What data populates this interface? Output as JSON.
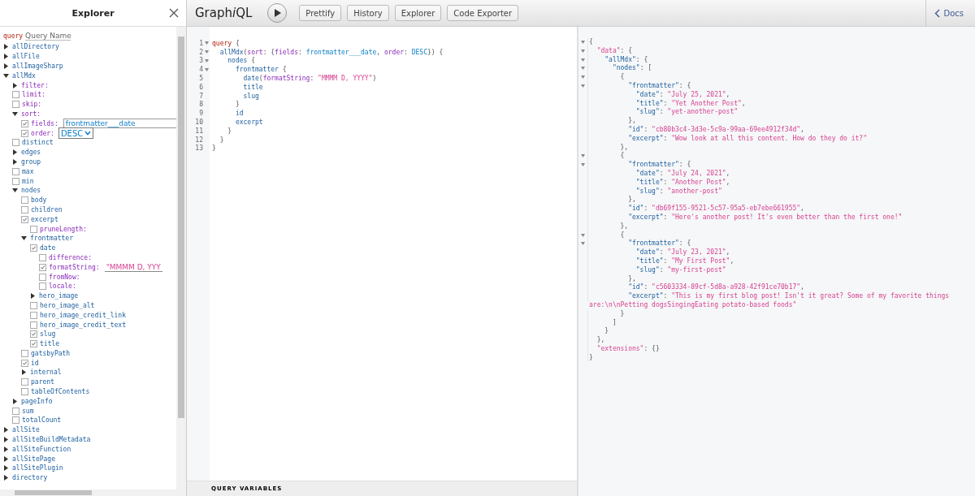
{
  "explorer": {
    "title": "Explorer",
    "operation": {
      "keyword": "query",
      "placeholder": "Query Name"
    },
    "tree": [
      {
        "label": "allDirectory",
        "kind": "object",
        "expanded": false
      },
      {
        "label": "allFile",
        "kind": "object",
        "expanded": false
      },
      {
        "label": "allImageSharp",
        "kind": "object",
        "expanded": false
      },
      {
        "label": "allMdx",
        "kind": "object",
        "expanded": true,
        "children": [
          {
            "label": "filter:",
            "kind": "arg_object",
            "expanded": false
          },
          {
            "label": "limit:",
            "kind": "arg",
            "checked": false
          },
          {
            "label": "skip:",
            "kind": "arg",
            "checked": false
          },
          {
            "label": "sort:",
            "kind": "arg_object",
            "expanded": true,
            "children": [
              {
                "label": "fields:",
                "kind": "arg",
                "checked": true,
                "value": {
                  "text": "frontmatter___date",
                  "kind": "enum"
                }
              },
              {
                "label": "order:",
                "kind": "arg",
                "checked": true,
                "select": "DESC"
              }
            ]
          },
          {
            "label": "distinct",
            "kind": "field",
            "checked": false
          },
          {
            "label": "edges",
            "kind": "object",
            "expanded": false
          },
          {
            "label": "group",
            "kind": "object",
            "expanded": false
          },
          {
            "label": "max",
            "kind": "field",
            "checked": false
          },
          {
            "label": "min",
            "kind": "field",
            "checked": false
          },
          {
            "label": "nodes",
            "kind": "object",
            "expanded": true,
            "children": [
              {
                "label": "body",
                "kind": "field",
                "checked": false
              },
              {
                "label": "children",
                "kind": "field",
                "checked": false
              },
              {
                "label": "excerpt",
                "kind": "field",
                "checked": true,
                "children": [
                  {
                    "label": "pruneLength:",
                    "kind": "arg",
                    "checked": false
                  }
                ]
              },
              {
                "label": "frontmatter",
                "kind": "object",
                "expanded": true,
                "children": [
                  {
                    "label": "date",
                    "kind": "field",
                    "checked": true,
                    "children": [
                      {
                        "label": "difference:",
                        "kind": "arg",
                        "checked": false
                      },
                      {
                        "label": "formatString:",
                        "kind": "arg",
                        "checked": true,
                        "value": {
                          "text": "\"MMMM D, YYY",
                          "kind": "string"
                        }
                      },
                      {
                        "label": "fromNow:",
                        "kind": "arg",
                        "checked": false
                      },
                      {
                        "label": "locale:",
                        "kind": "arg",
                        "checked": false
                      }
                    ]
                  },
                  {
                    "label": "hero_image",
                    "kind": "object",
                    "expanded": false
                  },
                  {
                    "label": "hero_image_alt",
                    "kind": "field",
                    "checked": false
                  },
                  {
                    "label": "hero_image_credit_link",
                    "kind": "field",
                    "checked": false
                  },
                  {
                    "label": "hero_image_credit_text",
                    "kind": "field",
                    "checked": false
                  },
                  {
                    "label": "slug",
                    "kind": "field",
                    "checked": true
                  },
                  {
                    "label": "title",
                    "kind": "field",
                    "checked": true
                  }
                ]
              },
              {
                "label": "gatsbyPath",
                "kind": "field",
                "checked": false
              },
              {
                "label": "id",
                "kind": "field",
                "checked": true
              },
              {
                "label": "internal",
                "kind": "object",
                "expanded": false
              },
              {
                "label": "parent",
                "kind": "field",
                "checked": false
              },
              {
                "label": "tableOfContents",
                "kind": "field",
                "checked": false
              }
            ]
          },
          {
            "label": "pageInfo",
            "kind": "object",
            "expanded": false
          },
          {
            "label": "sum",
            "kind": "field",
            "checked": false
          },
          {
            "label": "totalCount",
            "kind": "field",
            "checked": false
          }
        ]
      },
      {
        "label": "allSite",
        "kind": "object",
        "expanded": false
      },
      {
        "label": "allSiteBuildMetadata",
        "kind": "object",
        "expanded": false
      },
      {
        "label": "allSiteFunction",
        "kind": "object",
        "expanded": false
      },
      {
        "label": "allSitePage",
        "kind": "object",
        "expanded": false
      },
      {
        "label": "allSitePlugin",
        "kind": "object",
        "expanded": false
      },
      {
        "label": "directory",
        "kind": "object",
        "expanded": false
      }
    ]
  },
  "toolbar": {
    "logo": [
      {
        "text": "Graph",
        "italic": false
      },
      {
        "text": "i",
        "italic": true
      },
      {
        "text": "QL",
        "italic": false
      }
    ],
    "buttons": [
      "Prettify",
      "History",
      "Explorer",
      "Code Exporter"
    ],
    "docs": "Docs"
  },
  "query_editor": {
    "lines": [
      {
        "number": "1",
        "foldable": true,
        "tokens": [
          {
            "text": "query",
            "kind": "keyword"
          },
          {
            "text": " {",
            "kind": "punct"
          }
        ]
      },
      {
        "number": "2",
        "foldable": true,
        "tokens": [
          {
            "text": "  allMdx",
            "kind": "property"
          },
          {
            "text": "(",
            "kind": "punct"
          },
          {
            "text": "sort",
            "kind": "attribute"
          },
          {
            "text": ": {",
            "kind": "punct"
          },
          {
            "text": "fields",
            "kind": "attribute"
          },
          {
            "text": ": ",
            "kind": "punct"
          },
          {
            "text": "frontmatter___date",
            "kind": "enum"
          },
          {
            "text": ", ",
            "kind": "punct"
          },
          {
            "text": "order",
            "kind": "attribute"
          },
          {
            "text": ": ",
            "kind": "punct"
          },
          {
            "text": "DESC",
            "kind": "enum"
          },
          {
            "text": "}) {",
            "kind": "punct"
          }
        ]
      },
      {
        "number": "3",
        "foldable": true,
        "tokens": [
          {
            "text": "    nodes",
            "kind": "property"
          },
          {
            "text": " {",
            "kind": "punct"
          }
        ]
      },
      {
        "number": "4",
        "foldable": true,
        "tokens": [
          {
            "text": "      frontmatter",
            "kind": "property"
          },
          {
            "text": " {",
            "kind": "punct"
          }
        ]
      },
      {
        "number": "5",
        "foldable": false,
        "tokens": [
          {
            "text": "        date",
            "kind": "property"
          },
          {
            "text": "(",
            "kind": "punct"
          },
          {
            "text": "formatString",
            "kind": "attribute"
          },
          {
            "text": ": ",
            "kind": "punct"
          },
          {
            "text": "\"MMMM D, YYYY\"",
            "kind": "string"
          },
          {
            "text": ")",
            "kind": "punct"
          }
        ]
      },
      {
        "number": "6",
        "foldable": false,
        "tokens": [
          {
            "text": "        title",
            "kind": "property"
          }
        ]
      },
      {
        "number": "7",
        "foldable": false,
        "tokens": [
          {
            "text": "        slug",
            "kind": "property"
          }
        ]
      },
      {
        "number": "8",
        "foldable": false,
        "tokens": [
          {
            "text": "      }",
            "kind": "punct"
          }
        ]
      },
      {
        "number": "9",
        "foldable": false,
        "tokens": [
          {
            "text": "      id",
            "kind": "property"
          }
        ]
      },
      {
        "number": "10",
        "foldable": false,
        "tokens": [
          {
            "text": "      excerpt",
            "kind": "property"
          }
        ]
      },
      {
        "number": "11",
        "foldable": false,
        "tokens": [
          {
            "text": "    }",
            "kind": "punct"
          }
        ]
      },
      {
        "number": "12",
        "foldable": false,
        "tokens": [
          {
            "text": "  }",
            "kind": "punct"
          }
        ]
      },
      {
        "number": "13",
        "foldable": false,
        "tokens": [
          {
            "text": "}",
            "kind": "punct"
          }
        ]
      }
    ],
    "variables_label": "QUERY VARIABLES"
  },
  "result": {
    "lines": [
      {
        "foldable": true,
        "tokens": [
          {
            "text": "{",
            "kind": "punct"
          }
        ]
      },
      {
        "foldable": true,
        "tokens": [
          {
            "text": "  \"data\"",
            "kind": "string"
          },
          {
            "text": ": {",
            "kind": "punct"
          }
        ]
      },
      {
        "foldable": true,
        "tokens": [
          {
            "text": "    \"allMdx\"",
            "kind": "property"
          },
          {
            "text": ": {",
            "kind": "punct"
          }
        ]
      },
      {
        "foldable": true,
        "tokens": [
          {
            "text": "      \"nodes\"",
            "kind": "property"
          },
          {
            "text": ": [",
            "kind": "punct"
          }
        ]
      },
      {
        "foldable": true,
        "tokens": [
          {
            "text": "        {",
            "kind": "punct"
          }
        ]
      },
      {
        "foldable": true,
        "tokens": [
          {
            "text": "          \"frontmatter\"",
            "kind": "property"
          },
          {
            "text": ": {",
            "kind": "punct"
          }
        ]
      },
      {
        "foldable": false,
        "tokens": [
          {
            "text": "            \"date\"",
            "kind": "property"
          },
          {
            "text": ": ",
            "kind": "punct"
          },
          {
            "text": "\"July 25, 2021\"",
            "kind": "string"
          },
          {
            "text": ",",
            "kind": "punct"
          }
        ]
      },
      {
        "foldable": false,
        "tokens": [
          {
            "text": "            \"title\"",
            "kind": "property"
          },
          {
            "text": ": ",
            "kind": "punct"
          },
          {
            "text": "\"Yet Another Post\"",
            "kind": "string"
          },
          {
            "text": ",",
            "kind": "punct"
          }
        ]
      },
      {
        "foldable": false,
        "tokens": [
          {
            "text": "            \"slug\"",
            "kind": "property"
          },
          {
            "text": ": ",
            "kind": "punct"
          },
          {
            "text": "\"yet-another-post\"",
            "kind": "string"
          }
        ]
      },
      {
        "foldable": false,
        "tokens": [
          {
            "text": "          },",
            "kind": "punct"
          }
        ]
      },
      {
        "foldable": false,
        "tokens": [
          {
            "text": "          \"id\"",
            "kind": "property"
          },
          {
            "text": ": ",
            "kind": "punct"
          },
          {
            "text": "\"cb80b3c4-3d3e-5c9a-99aa-69ee4912f34d\"",
            "kind": "string"
          },
          {
            "text": ",",
            "kind": "punct"
          }
        ]
      },
      {
        "foldable": false,
        "tokens": [
          {
            "text": "          \"excerpt\"",
            "kind": "property"
          },
          {
            "text": ": ",
            "kind": "punct"
          },
          {
            "text": "\"Wow look at all this content. How do they do it?\"",
            "kind": "string"
          }
        ]
      },
      {
        "foldable": false,
        "tokens": [
          {
            "text": "        },",
            "kind": "punct"
          }
        ]
      },
      {
        "foldable": true,
        "tokens": [
          {
            "text": "        {",
            "kind": "punct"
          }
        ]
      },
      {
        "foldable": true,
        "tokens": [
          {
            "text": "          \"frontmatter\"",
            "kind": "property"
          },
          {
            "text": ": {",
            "kind": "punct"
          }
        ]
      },
      {
        "foldable": false,
        "tokens": [
          {
            "text": "            \"date\"",
            "kind": "property"
          },
          {
            "text": ": ",
            "kind": "punct"
          },
          {
            "text": "\"July 24, 2021\"",
            "kind": "string"
          },
          {
            "text": ",",
            "kind": "punct"
          }
        ]
      },
      {
        "foldable": false,
        "tokens": [
          {
            "text": "            \"title\"",
            "kind": "property"
          },
          {
            "text": ": ",
            "kind": "punct"
          },
          {
            "text": "\"Another Post\"",
            "kind": "string"
          },
          {
            "text": ",",
            "kind": "punct"
          }
        ]
      },
      {
        "foldable": false,
        "tokens": [
          {
            "text": "            \"slug\"",
            "kind": "property"
          },
          {
            "text": ": ",
            "kind": "punct"
          },
          {
            "text": "\"another-post\"",
            "kind": "string"
          }
        ]
      },
      {
        "foldable": false,
        "tokens": [
          {
            "text": "          },",
            "kind": "punct"
          }
        ]
      },
      {
        "foldable": false,
        "tokens": [
          {
            "text": "          \"id\"",
            "kind": "property"
          },
          {
            "text": ": ",
            "kind": "punct"
          },
          {
            "text": "\"db69f155-9521-5c57-95a5-eb7ebe661955\"",
            "kind": "string"
          },
          {
            "text": ",",
            "kind": "punct"
          }
        ]
      },
      {
        "foldable": false,
        "tokens": [
          {
            "text": "          \"excerpt\"",
            "kind": "property"
          },
          {
            "text": ": ",
            "kind": "punct"
          },
          {
            "text": "\"Here's another post! It's even better than the first one!\"",
            "kind": "string"
          }
        ]
      },
      {
        "foldable": false,
        "tokens": [
          {
            "text": "        },",
            "kind": "punct"
          }
        ]
      },
      {
        "foldable": true,
        "tokens": [
          {
            "text": "        {",
            "kind": "punct"
          }
        ]
      },
      {
        "foldable": true,
        "tokens": [
          {
            "text": "          \"frontmatter\"",
            "kind": "property"
          },
          {
            "text": ": {",
            "kind": "punct"
          }
        ]
      },
      {
        "foldable": false,
        "tokens": [
          {
            "text": "            \"date\"",
            "kind": "property"
          },
          {
            "text": ": ",
            "kind": "punct"
          },
          {
            "text": "\"July 23, 2021\"",
            "kind": "string"
          },
          {
            "text": ",",
            "kind": "punct"
          }
        ]
      },
      {
        "foldable": false,
        "tokens": [
          {
            "text": "            \"title\"",
            "kind": "property"
          },
          {
            "text": ": ",
            "kind": "punct"
          },
          {
            "text": "\"My First Post\"",
            "kind": "string"
          },
          {
            "text": ",",
            "kind": "punct"
          }
        ]
      },
      {
        "foldable": false,
        "tokens": [
          {
            "text": "            \"slug\"",
            "kind": "property"
          },
          {
            "text": ": ",
            "kind": "punct"
          },
          {
            "text": "\"my-first-post\"",
            "kind": "string"
          }
        ]
      },
      {
        "foldable": false,
        "tokens": [
          {
            "text": "          },",
            "kind": "punct"
          }
        ]
      },
      {
        "foldable": false,
        "tokens": [
          {
            "text": "          \"id\"",
            "kind": "property"
          },
          {
            "text": ": ",
            "kind": "punct"
          },
          {
            "text": "\"c5603334-89cf-5d8a-a928-42f91ce70b17\"",
            "kind": "string"
          },
          {
            "text": ",",
            "kind": "punct"
          }
        ]
      },
      {
        "foldable": false,
        "tokens": [
          {
            "text": "          \"excerpt\"",
            "kind": "property"
          },
          {
            "text": ": ",
            "kind": "punct"
          },
          {
            "text": "\"This is my first blog post! Isn't it great? Some of my favorite things are:\\n\\nPetting dogsSingingEating potato-based foods\"",
            "kind": "string"
          }
        ]
      },
      {
        "foldable": false,
        "tokens": [
          {
            "text": "        }",
            "kind": "punct"
          }
        ]
      },
      {
        "foldable": false,
        "tokens": [
          {
            "text": "      ]",
            "kind": "punct"
          }
        ]
      },
      {
        "foldable": false,
        "tokens": [
          {
            "text": "    }",
            "kind": "punct"
          }
        ]
      },
      {
        "foldable": false,
        "tokens": [
          {
            "text": "  },",
            "kind": "punct"
          }
        ]
      },
      {
        "foldable": false,
        "tokens": [
          {
            "text": "  \"extensions\"",
            "kind": "string"
          },
          {
            "text": ": {}",
            "kind": "punct"
          }
        ]
      },
      {
        "foldable": false,
        "tokens": [
          {
            "text": "}",
            "kind": "punct"
          }
        ]
      }
    ]
  }
}
